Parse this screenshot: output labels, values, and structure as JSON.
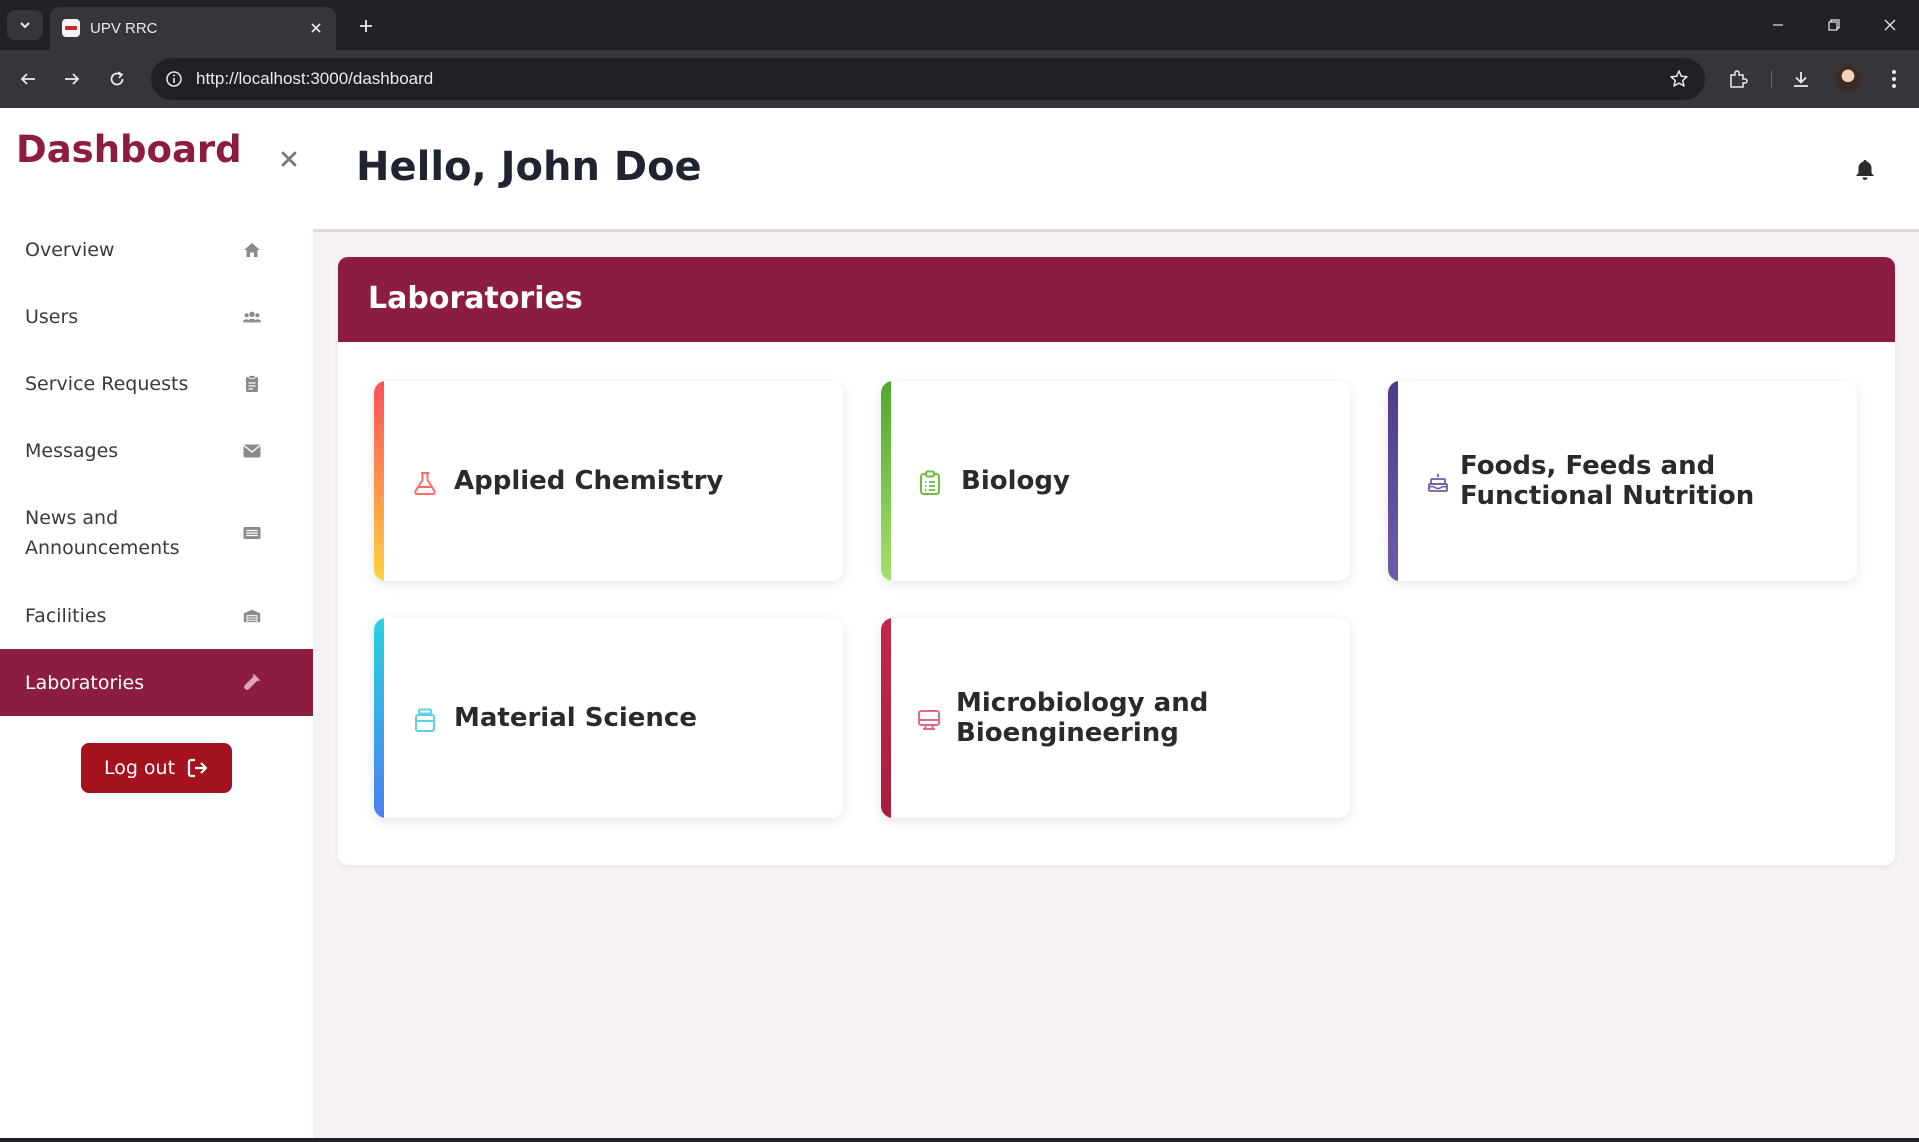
{
  "browser": {
    "tab_title": "UPV RRC",
    "url": "http://localhost:3000/dashboard"
  },
  "sidebar": {
    "title": "Dashboard",
    "items": [
      {
        "label": "Overview",
        "icon": "home-icon"
      },
      {
        "label": "Users",
        "icon": "users-icon"
      },
      {
        "label": "Service Requests",
        "icon": "clipboard-icon"
      },
      {
        "label": "Messages",
        "icon": "envelope-icon"
      },
      {
        "label": "News and Announcements",
        "icon": "newspaper-icon"
      },
      {
        "label": "Facilities",
        "icon": "warehouse-icon"
      },
      {
        "label": "Laboratories",
        "icon": "flask-icon",
        "active": true
      }
    ],
    "logout_label": "Log out"
  },
  "header": {
    "greeting": "Hello, John Doe"
  },
  "labs": {
    "title": "Laboratories",
    "cards": [
      {
        "name": "Applied Chemistry",
        "icon": "flask-icon",
        "accent": "#ff5a4f"
      },
      {
        "name": "Biology",
        "icon": "clipboard-list-icon",
        "accent": "#6cbf3c"
      },
      {
        "name": "Foods, Feeds and Functional Nutrition",
        "icon": "cake-icon",
        "accent": "#5b4a8e"
      },
      {
        "name": "Material Science",
        "icon": "jar-icon",
        "accent": "#29c4e0"
      },
      {
        "name": "Microbiology and Bioengineering",
        "icon": "monitor-icon",
        "accent": "#c2294a"
      }
    ]
  },
  "colors": {
    "brand": "#8c1c40",
    "logout": "#a3121d",
    "page_bg": "#f6f2f6"
  }
}
